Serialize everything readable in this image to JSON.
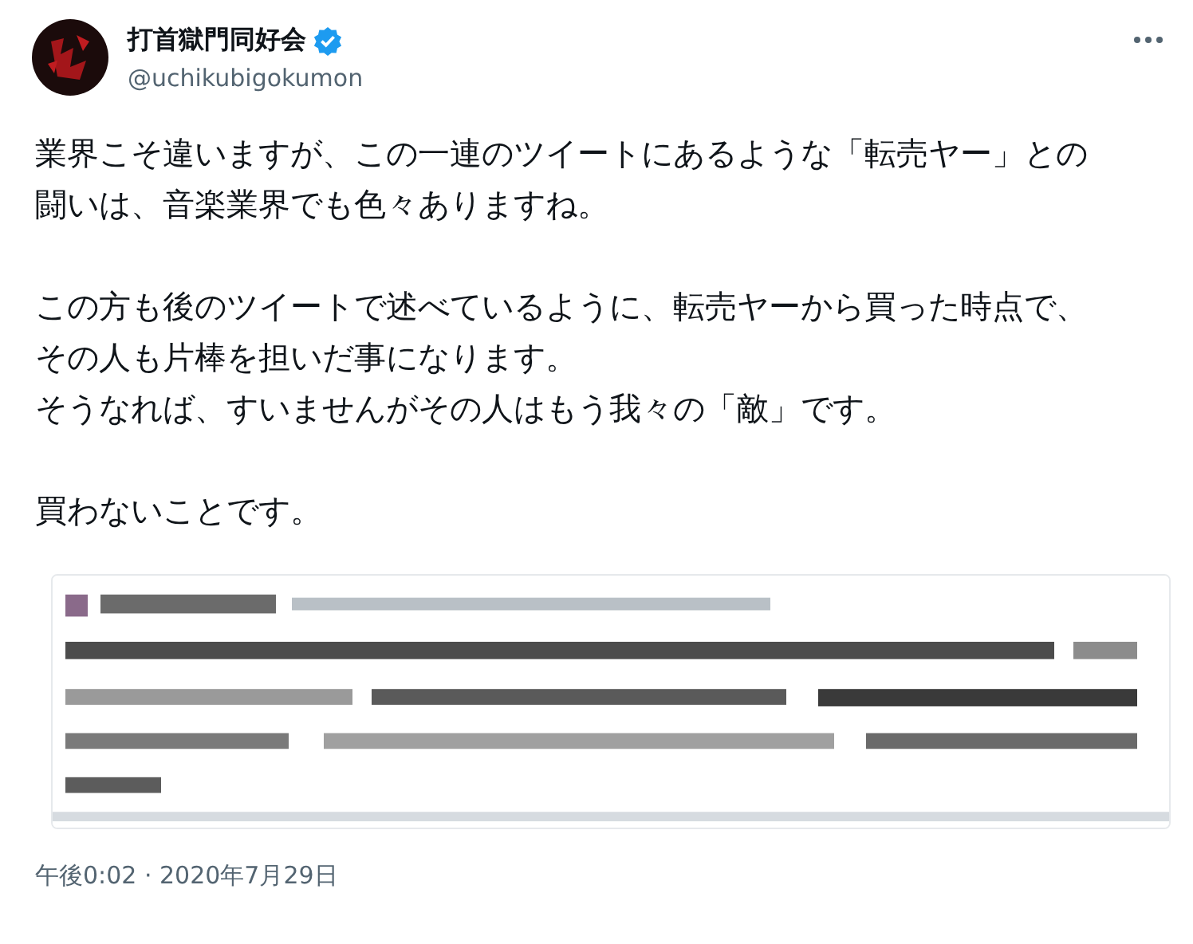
{
  "author": {
    "name": "打首獄門同好会",
    "verified": true,
    "handle": "@uchikubigokumon"
  },
  "body": [
    [
      "業界こそ違いますが、この一連のツイートにあるような「転売ヤー」との闘いは、音楽業界でも色々ありますね。"
    ],
    [
      "この方も後のツイートで述べているように、転売ヤーから買った時点で、その人も片棒を担いだ事になります。",
      "そうなれば、すいませんがその人はもう我々の「敵」です。"
    ],
    [
      "買わないことです。"
    ]
  ],
  "quoted_tweet": {
    "kind": "picture"
  },
  "timestamp": "午後0:02 · 2020年7月29日"
}
